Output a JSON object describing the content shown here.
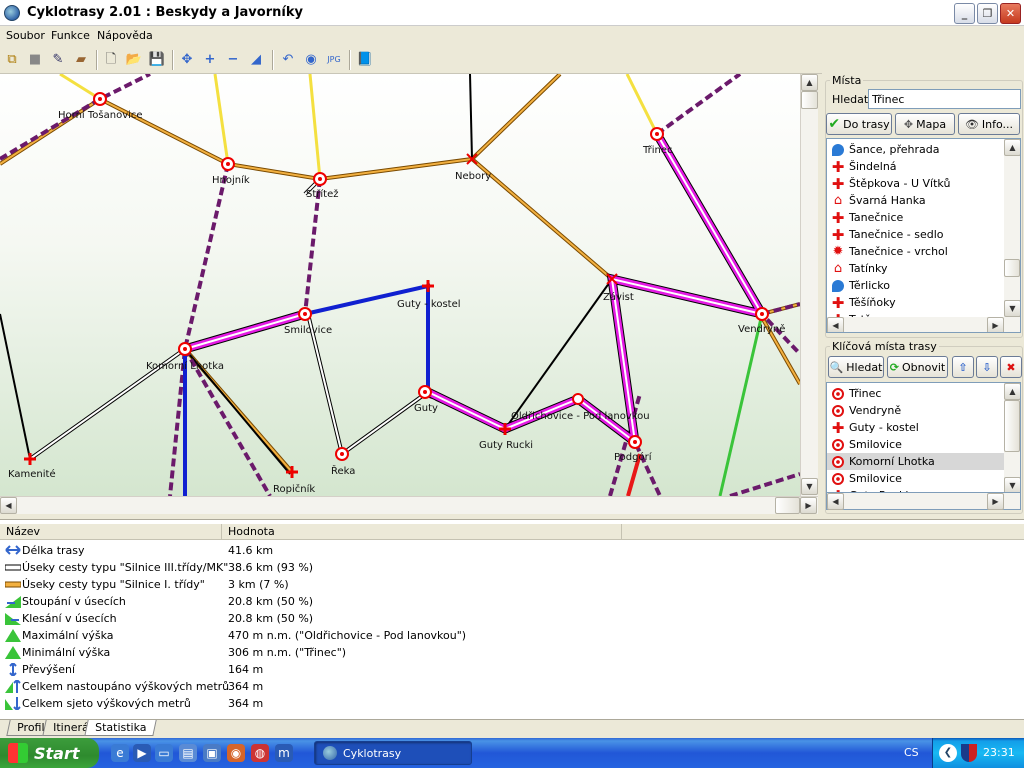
{
  "window": {
    "title": "Cyklotrasy 2.01 : Beskydy a Javorníky"
  },
  "menu": [
    "Soubor",
    "Funkce",
    "Nápověda"
  ],
  "map": {
    "places": [
      "Horní Tošanovice",
      "Hnojník",
      "Střítež",
      "Nebory",
      "Třinec",
      "Guty - kostel",
      "Smilovice",
      "Komorní Lhotka",
      "Závist",
      "Vendryně",
      "Guty",
      "Oldřichovice - Pod lanovkou",
      "Guty Rucki",
      "Podgórí",
      "Řeka",
      "Kamenité",
      "Ropičník"
    ]
  },
  "places_panel": {
    "group_title": "Místa",
    "search_label": "Hledat",
    "search_value": "Třinec",
    "btn_to_route": "Do trasy",
    "btn_map": "Mapa",
    "btn_info": "Info...",
    "items": [
      {
        "icon": "water",
        "label": "Šance, přehrada"
      },
      {
        "icon": "cross",
        "label": "Šindelná"
      },
      {
        "icon": "cross",
        "label": "Štěpkova - U Vítků"
      },
      {
        "icon": "house",
        "label": "Švarná Hanka"
      },
      {
        "icon": "cross",
        "label": "Tanečnice"
      },
      {
        "icon": "cross",
        "label": "Tanečnice - sedlo"
      },
      {
        "icon": "gear",
        "label": "Tanečnice - vrchol"
      },
      {
        "icon": "house",
        "label": "Tatínky"
      },
      {
        "icon": "water",
        "label": "Těrlicko"
      },
      {
        "icon": "cross",
        "label": "Těšíňoky"
      },
      {
        "icon": "cross",
        "label": "Tetřev"
      }
    ]
  },
  "keypoints_panel": {
    "group_title": "Klíčová místa trasy",
    "btn_search": "Hledat",
    "btn_refresh": "Obnovit",
    "items": [
      {
        "icon": "target",
        "label": "Třinec",
        "selected": false
      },
      {
        "icon": "target",
        "label": "Vendryně",
        "selected": false
      },
      {
        "icon": "cross",
        "label": "Guty - kostel",
        "selected": false
      },
      {
        "icon": "target",
        "label": "Smilovice",
        "selected": false
      },
      {
        "icon": "target",
        "label": "Komorní Lhotka",
        "selected": true
      },
      {
        "icon": "target",
        "label": "Smilovice",
        "selected": false
      },
      {
        "icon": "cross",
        "label": "Guty Rucki",
        "selected": false
      }
    ]
  },
  "stats": {
    "col_name": "Název",
    "col_value": "Hodnota",
    "rows": [
      {
        "icon": "length",
        "name": "Délka trasy",
        "value": "41.6 km"
      },
      {
        "icon": "road3",
        "name": "Úseky cesty typu \"Silnice III.třídy/MK\"",
        "value": "38.6 km (93 %)"
      },
      {
        "icon": "road1",
        "name": "Úseky cesty typu \"Silnice I. třídy\"",
        "value": "3 km (7 %)"
      },
      {
        "icon": "climb",
        "name": "Stoupání v úsecích",
        "value": "20.8 km (50 %)"
      },
      {
        "icon": "descent",
        "name": "Klesání v úsecích",
        "value": "20.8 km (50 %)"
      },
      {
        "icon": "maxh",
        "name": "Maximální výška",
        "value": "470 m n.m. (\"Oldřichovice - Pod lanovkou\")"
      },
      {
        "icon": "minh",
        "name": "Minimální výška",
        "value": "306 m n.m. (\"Třinec\")"
      },
      {
        "icon": "diff",
        "name": "Převýšení",
        "value": "164 m"
      },
      {
        "icon": "up",
        "name": "Celkem nastoupáno výškových metrů",
        "value": "364 m"
      },
      {
        "icon": "down",
        "name": "Celkem sjeto výškových metrů",
        "value": "364 m"
      }
    ]
  },
  "tabs": [
    "Profil",
    "Itinerář",
    "Statistika"
  ],
  "taskbar": {
    "start": "Start",
    "task": "Cyklotrasy",
    "lang": "CS",
    "clock": "23:31"
  }
}
